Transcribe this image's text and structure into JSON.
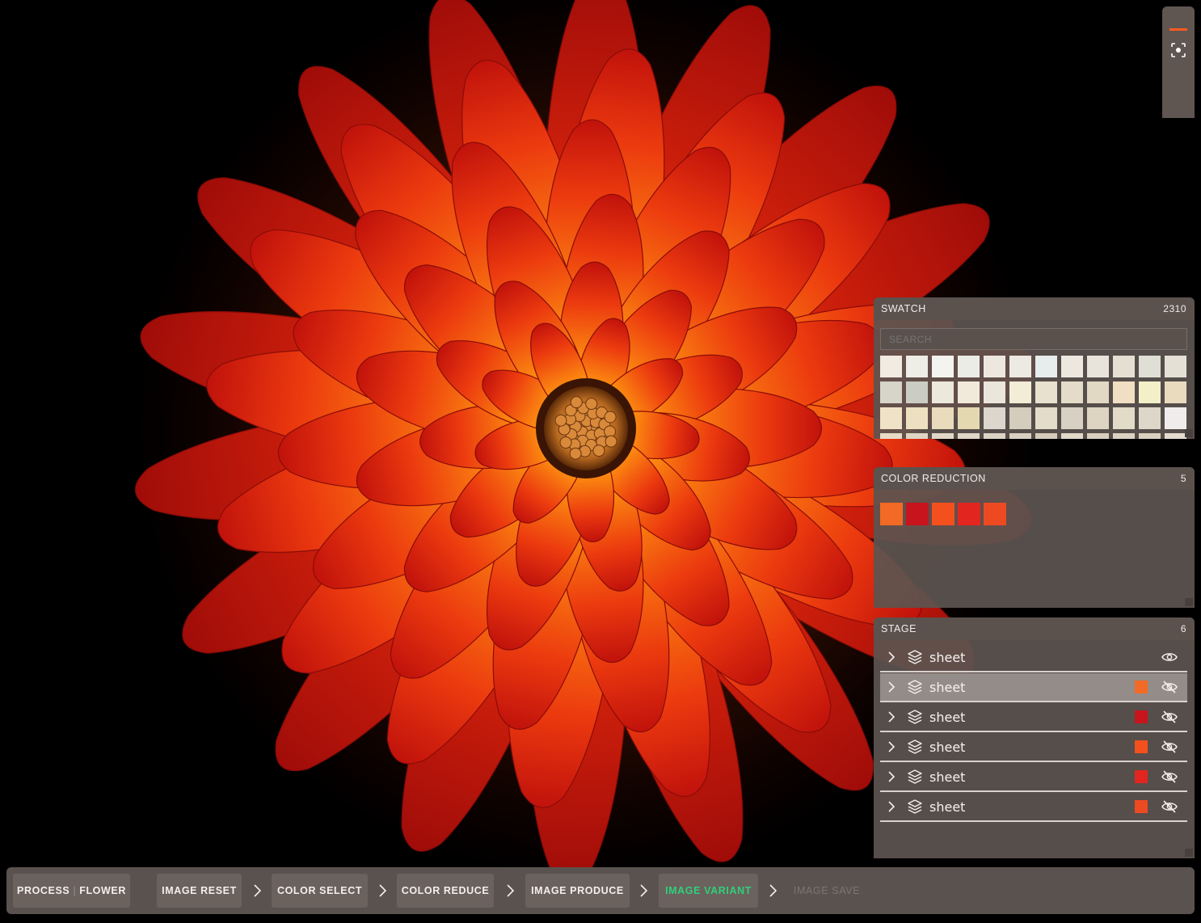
{
  "image": {
    "subject": "flower"
  },
  "colors": {
    "panel_bg": "#5c5450",
    "accent": "#ff5a1f",
    "active_step": "#2fd07a"
  },
  "mini_toolbar": {
    "icon": "focus-icon"
  },
  "swatch": {
    "title": "SWATCH",
    "count": "2310",
    "search_placeholder": "SEARCH",
    "colors": [
      "#f1ebe2",
      "#eeede6",
      "#f3f3ef",
      "#ecece7",
      "#ece8e0",
      "#eceae2",
      "#e7ecec",
      "#ece8df",
      "#e8e4dc",
      "#e3e0d3",
      "#e0dfd6",
      "#e4e0d6",
      "#d7d4ca",
      "#cbcdc4",
      "#ede8dc",
      "#f1eadb",
      "#ebe6db",
      "#f3edd8",
      "#e8e1cf",
      "#e4dbc9",
      "#e2d9c5",
      "#f1dfc3",
      "#f3f0c9",
      "#eadbbf",
      "#f0e2c6",
      "#ece0c0",
      "#e8dcbc",
      "#e4d8b1",
      "#dcd6cc",
      "#d4ccbc",
      "#e4dcca",
      "#d8d0c2",
      "#ddd5c2",
      "#e1dbc8",
      "#ddd7ca",
      "#f1ecec",
      "#e7dbc8",
      "#e0d5c4",
      "#e0d7c7",
      "#ded6c6",
      "#dcd4c4",
      "#d8d1c2",
      "#d6ccbc",
      "#e1d8c8",
      "#d8cfbf",
      "#dbd2c2",
      "#d9d0c0",
      "#e3dccf"
    ]
  },
  "color_reduction": {
    "title": "COLOR REDUCTION",
    "count": "5",
    "colors": [
      "#f26a25",
      "#c8141c",
      "#f4501e",
      "#e3251f",
      "#ee4a22"
    ]
  },
  "stage": {
    "title": "STAGE",
    "count": "6",
    "layers": [
      {
        "name": "sheet",
        "color": null,
        "visible": true,
        "selected": false
      },
      {
        "name": "sheet",
        "color": "#f26a25",
        "visible": false,
        "selected": true
      },
      {
        "name": "sheet",
        "color": "#c8141c",
        "visible": false,
        "selected": false
      },
      {
        "name": "sheet",
        "color": "#f4501e",
        "visible": false,
        "selected": false
      },
      {
        "name": "sheet",
        "color": "#e3251f",
        "visible": false,
        "selected": false
      },
      {
        "name": "sheet",
        "color": "#ee4a22",
        "visible": false,
        "selected": false
      }
    ]
  },
  "pipeline": {
    "process_label": "PROCESS",
    "separator": "|",
    "project_label": "FLOWER",
    "steps": [
      {
        "label": "IMAGE RESET",
        "state": "done"
      },
      {
        "label": "COLOR SELECT",
        "state": "done"
      },
      {
        "label": "COLOR REDUCE",
        "state": "done"
      },
      {
        "label": "IMAGE PRODUCE",
        "state": "done"
      },
      {
        "label": "IMAGE VARIANT",
        "state": "active"
      },
      {
        "label": "IMAGE SAVE",
        "state": "disabled"
      }
    ]
  }
}
